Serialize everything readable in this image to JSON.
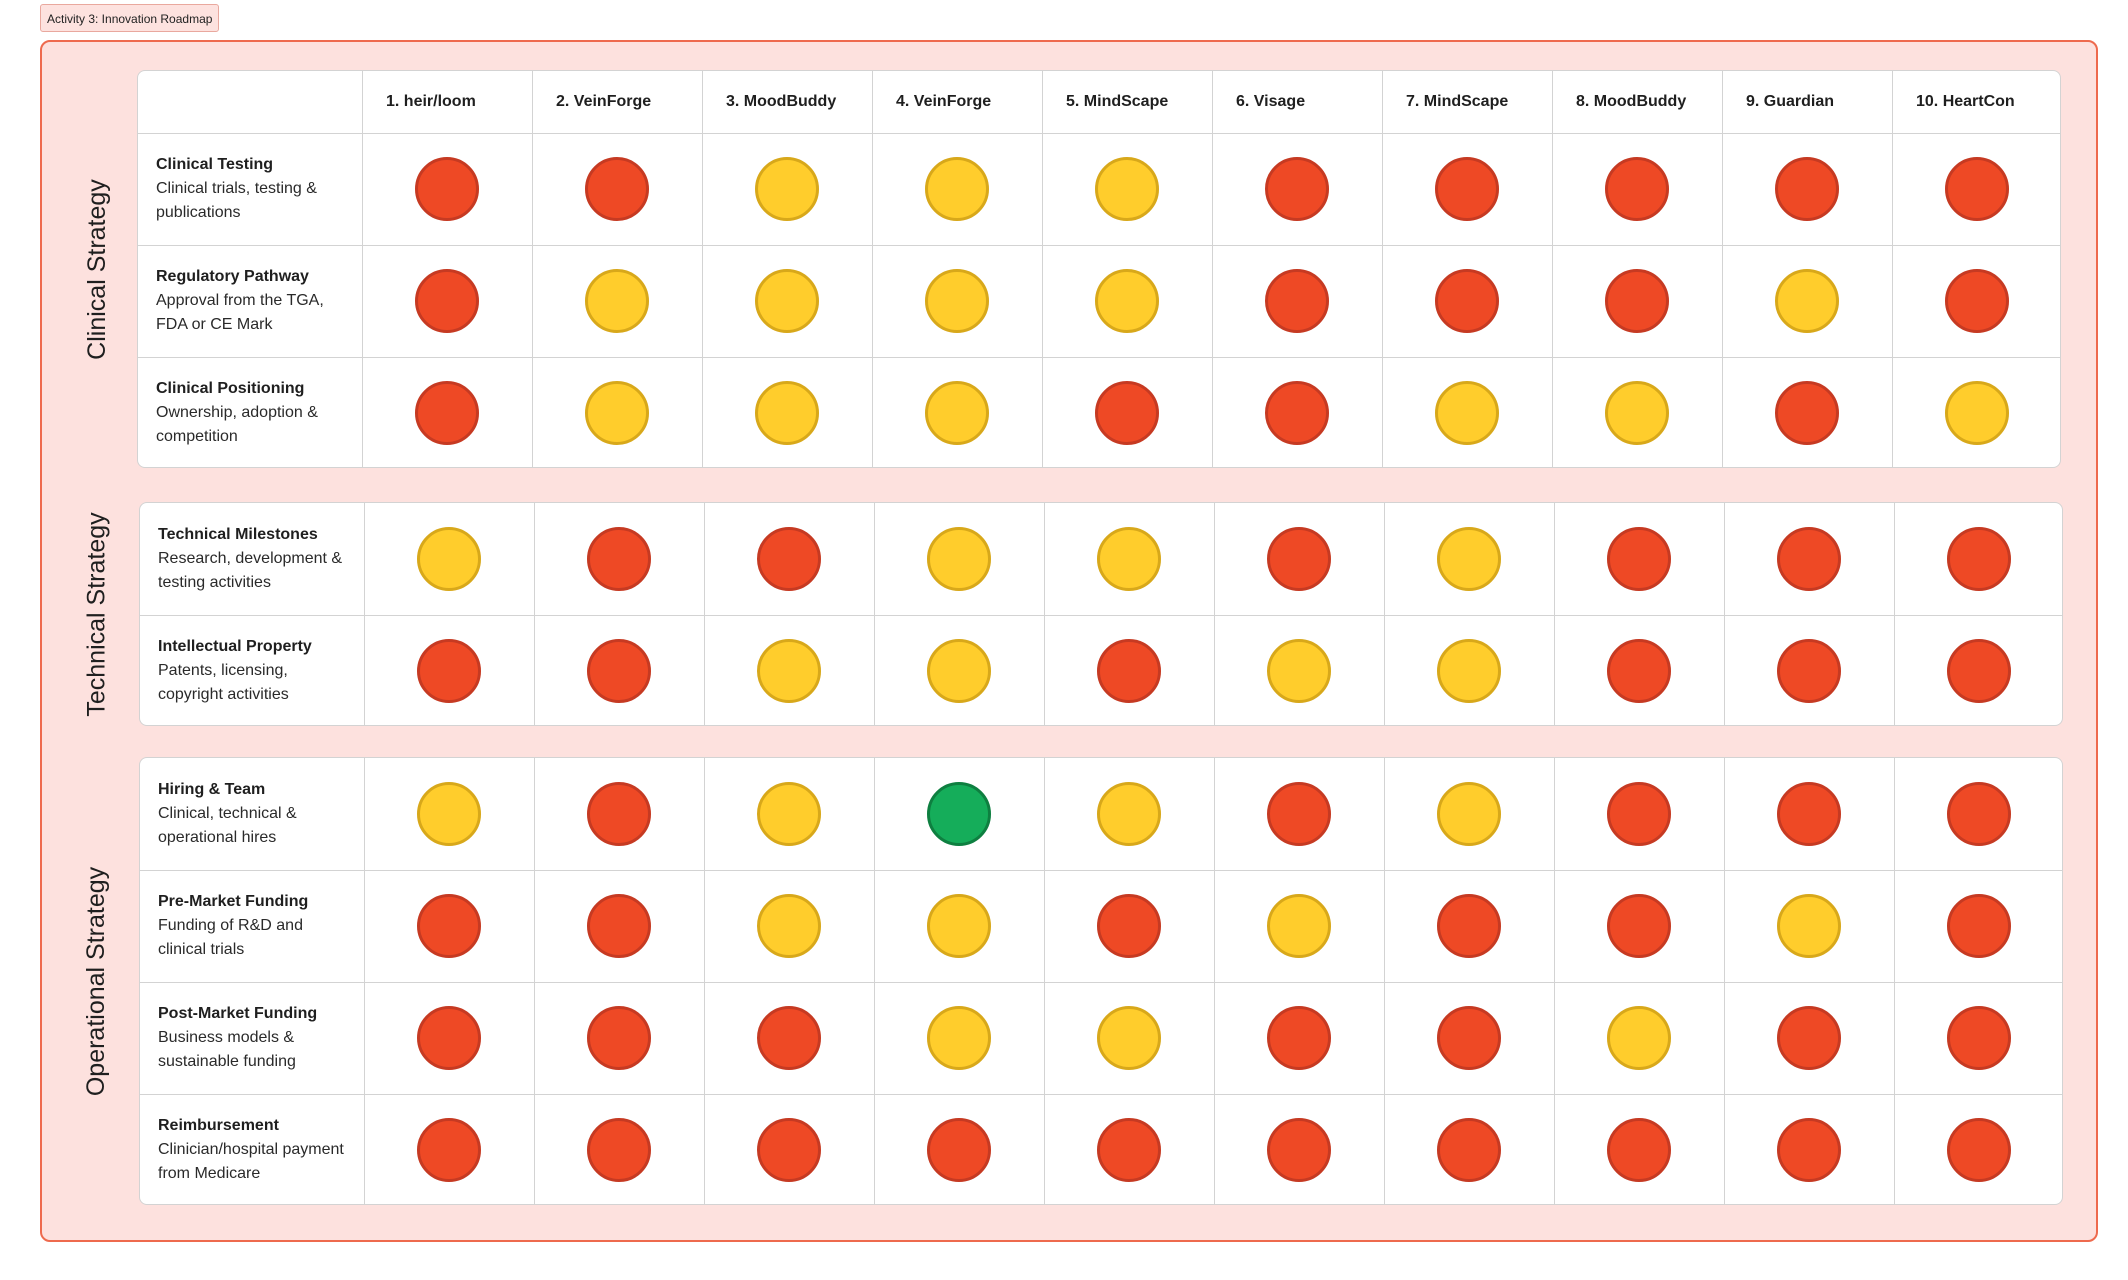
{
  "frame_label": "Activity 3: Innovation Roadmap",
  "colors": {
    "red": "#ee4925",
    "yellow": "#ffcd2c",
    "green": "#15ad5a",
    "background": "#fde1de",
    "border": "#ee6a4e"
  },
  "columns": [
    "1. heir/loom",
    "2. VeinForge",
    "3. MoodBuddy",
    "4. VeinForge",
    "5. MindScape",
    "6. Visage",
    "7. MindScape",
    "8. MoodBuddy",
    "9. Guardian",
    "10. HeartCon"
  ],
  "sections": [
    {
      "name": "Clinical Strategy",
      "rows": [
        {
          "title": "Clinical Testing",
          "subtitle": "Clinical trials, testing & publications",
          "status": [
            "red",
            "red",
            "yellow",
            "yellow",
            "yellow",
            "red",
            "red",
            "red",
            "red",
            "red"
          ]
        },
        {
          "title": "Regulatory Pathway",
          "subtitle": "Approval from the TGA, FDA or CE Mark",
          "status": [
            "red",
            "yellow",
            "yellow",
            "yellow",
            "yellow",
            "red",
            "red",
            "red",
            "yellow",
            "red"
          ]
        },
        {
          "title": "Clinical Positioning",
          "subtitle": "Ownership, adoption & competition",
          "status": [
            "red",
            "yellow",
            "yellow",
            "yellow",
            "red",
            "red",
            "yellow",
            "yellow",
            "red",
            "yellow"
          ]
        }
      ]
    },
    {
      "name": "Technical Strategy",
      "rows": [
        {
          "title": "Technical Milestones",
          "subtitle": "Research, development & testing activities",
          "status": [
            "yellow",
            "red",
            "red",
            "yellow",
            "yellow",
            "red",
            "yellow",
            "red",
            "red",
            "red"
          ]
        },
        {
          "title": "Intellectual Property",
          "subtitle": "Patents, licensing, copyright activities",
          "status": [
            "red",
            "red",
            "yellow",
            "yellow",
            "red",
            "yellow",
            "yellow",
            "red",
            "red",
            "red"
          ]
        }
      ]
    },
    {
      "name": "Operational Strategy",
      "rows": [
        {
          "title": "Hiring & Team",
          "subtitle": "Clinical, technical & operational hires",
          "status": [
            "yellow",
            "red",
            "yellow",
            "green",
            "yellow",
            "red",
            "yellow",
            "red",
            "red",
            "red"
          ]
        },
        {
          "title": "Pre-Market Funding",
          "subtitle": "Funding of R&D and clinical trials",
          "status": [
            "red",
            "red",
            "yellow",
            "yellow",
            "red",
            "yellow",
            "red",
            "red",
            "yellow",
            "red"
          ]
        },
        {
          "title": "Post-Market Funding",
          "subtitle": "Business models & sustainable funding",
          "status": [
            "red",
            "red",
            "red",
            "yellow",
            "yellow",
            "red",
            "red",
            "yellow",
            "red",
            "red"
          ]
        },
        {
          "title": "Reimbursement",
          "subtitle": "Clinician/hospital payment from Medicare",
          "status": [
            "red",
            "red",
            "red",
            "red",
            "red",
            "red",
            "red",
            "red",
            "red",
            "red"
          ]
        }
      ]
    }
  ]
}
